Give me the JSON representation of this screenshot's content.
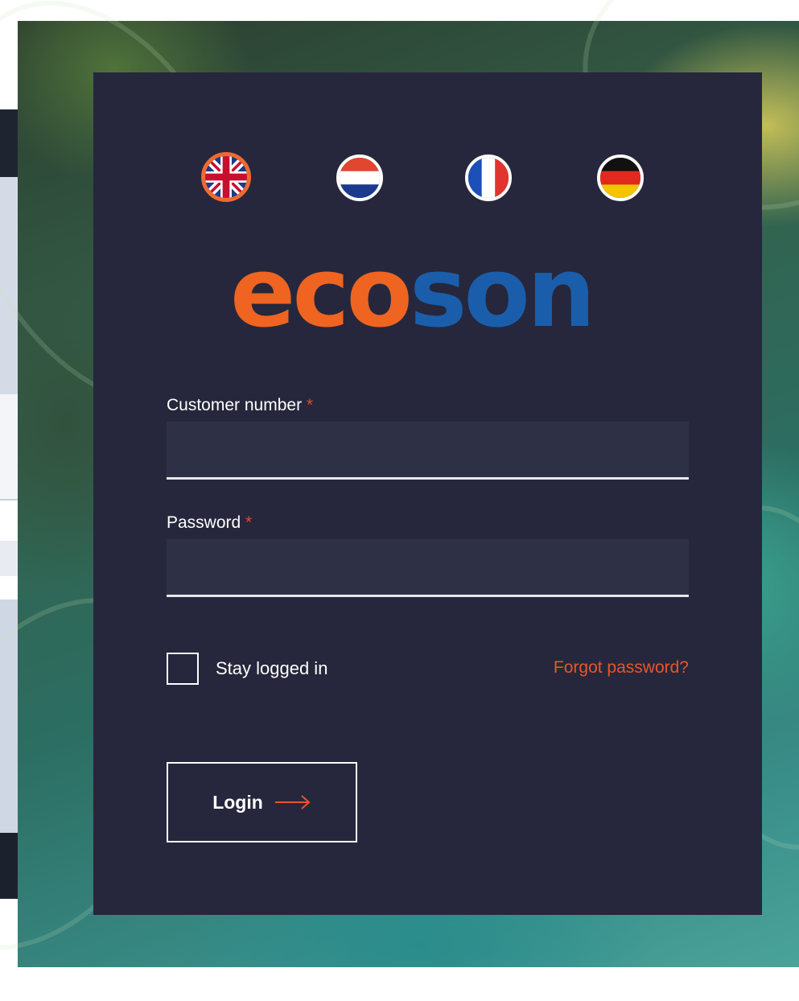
{
  "languages": [
    {
      "code": "en",
      "name": "English",
      "icon": "uk-flag-icon",
      "selected": true
    },
    {
      "code": "nl",
      "name": "Nederlands",
      "icon": "netherlands-flag-icon",
      "selected": false
    },
    {
      "code": "fr",
      "name": "Français",
      "icon": "france-flag-icon",
      "selected": false
    },
    {
      "code": "de",
      "name": "Deutsch",
      "icon": "germany-flag-icon",
      "selected": false
    }
  ],
  "logo": {
    "part1": "eco",
    "part2": "son",
    "color1": "#ef6420",
    "color2": "#1a5eab"
  },
  "form": {
    "customer_label": "Customer number",
    "password_label": "Password",
    "required_marker": "*",
    "customer_value": "",
    "password_value": "",
    "stay_logged_in_label": "Stay logged in",
    "stay_logged_in_checked": false,
    "forgot_password_label": "Forgot password?",
    "login_label": "Login",
    "login_icon": "arrow-right-icon"
  },
  "colors": {
    "card_background": "#26273c",
    "accent": "#e9552c",
    "input_background": "#2e3145"
  }
}
